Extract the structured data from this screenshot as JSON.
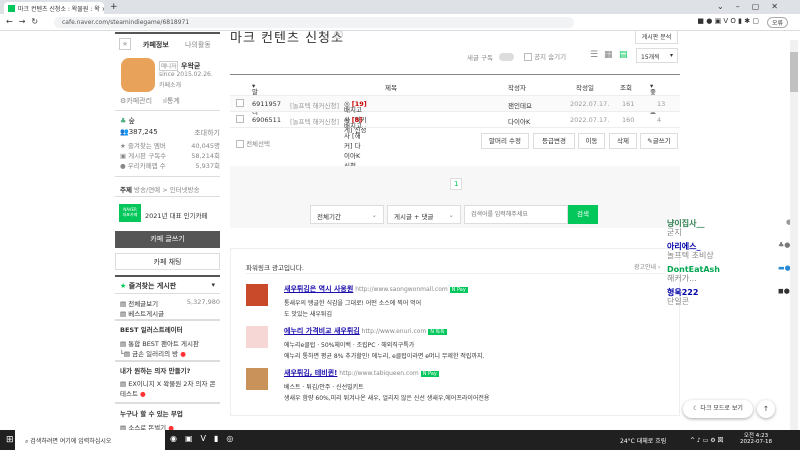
{
  "browser": {
    "tab_title": "마크 컨텐츠 신청소 : 왁물원 : 왁",
    "url": "cafe.naver.com/steamindiegame/6818971",
    "profile_label": "오류"
  },
  "sidebar": {
    "tabs": [
      "카페정보",
      "나의활동"
    ],
    "manager_label": "매니저",
    "manager_name": "우왁굳",
    "since": "since 2015.02.26.",
    "cafe_intro": "카페소개",
    "cafe_manage": "카페관리",
    "stats": "통계",
    "level": "숲",
    "members": "387,245",
    "invite": "초대하기",
    "stat_rows": [
      {
        "label": "즐겨찾는 멤버",
        "value": "40,045명"
      },
      {
        "label": "게시판 구독수",
        "value": "58,214회"
      },
      {
        "label": "우리카페앱 수",
        "value": "5,937회"
      }
    ],
    "topic_label": "주제",
    "topic": "방송/연예 > 인터넷방송",
    "naver_badge": "NAVER 대표카페",
    "award": "2021년 대표 인기카페",
    "write_btn": "카페 글쓰기",
    "chat_btn": "카페 채팅",
    "fav_header": "즐겨찾는 게시판",
    "boards": [
      {
        "label": "전체글보기",
        "count": "5,327,980"
      },
      {
        "label": "베스트게시글"
      }
    ],
    "sections": [
      {
        "title": "BEST 일러스트레이터",
        "items": [
          "통합 BEST 팬아트 게시판",
          "금손 일러리의 방"
        ]
      },
      {
        "title": "내가 원하는 의자 만들기?",
        "items": [
          "EX이니지 X 왁물원 2차 의자 콘테스트"
        ]
      },
      {
        "title": "누구나 할 수 있는 부업",
        "items": [
          "소스로 돈벌기"
        ]
      }
    ]
  },
  "main": {
    "title": "마크 컨텐츠 신청소",
    "analyze_btn": "게시판 분석",
    "subscribe": "새글 구독",
    "hide_notice": "공지 숨기기",
    "per_page": "15개씩",
    "columns": [
      "말머리",
      "제목",
      "작성자",
      "작성일",
      "조회",
      "좋아요"
    ],
    "rows": [
      {
        "id": "6911957",
        "prefix": "[놀프텍 해커신청]",
        "title": "배치고사 [마키게] 신청",
        "comments": "[19]",
        "author": "잰인데요",
        "date": "2022.07.17.",
        "views": "161",
        "likes": "13"
      },
      {
        "id": "6906511",
        "prefix": "[놀프텍 해커신청]",
        "title": "배치고사 [해커] 다이아K 신청",
        "comments": "[8]",
        "author": "다이아K",
        "date": "2022.07.17.",
        "views": "160",
        "likes": "4"
      }
    ],
    "select_all": "전체선택",
    "actions": [
      "말머리 수정",
      "등급변경",
      "이동",
      "삭제",
      "글쓰기"
    ],
    "page": "1",
    "search": {
      "period": "전체기간",
      "scope": "게시글 + 댓글",
      "placeholder": "검색어를 입력해주세요",
      "button": "검색"
    }
  },
  "ads": {
    "header": "파워링크 광고입니다.",
    "guide": "광고안내",
    "items": [
      {
        "title": "새우튀김은 역시 사옹원",
        "url": "http://www.saongwonmall.com",
        "badge": "N Pay",
        "lines": [
          "통새우의 탱글한 식감을 그대로! 어떤 소스에 찍어 먹어",
          "도 맛있는 새우튀김"
        ]
      },
      {
        "title": "에누리 가격비교 새우튀김",
        "url": "http://www.enuri.com",
        "badge": "N 톡톡",
        "lines": [
          "에누리e클럽 · 50%체이백 · 조립PC · 해외직구특가",
          "에누리 통하면 평균 8% 추가할인! 에누리, e클럽이라면 e머니 무제한 적립까지."
        ]
      },
      {
        "title": "새우튀김, 테비퀸!",
        "url": "http://www.tabiqueen.com",
        "badge": "N Pay",
        "lines": [
          "베스트 · 튀김/안주 · 신선밀키트",
          "생새우 함량 60%,미리 튀겨나온 새우, 얼리지 않은 신선 생새우,에어프라이어전용"
        ]
      }
    ]
  },
  "chat": [
    {
      "name": "냥이집사__",
      "msg": "굳지",
      "color": "#2e7d4f"
    },
    {
      "name": "아리에스_",
      "msg": "놀프텍 초비상",
      "color": "#0000aa"
    },
    {
      "name": "DontEatAsh",
      "msg": "해커가...",
      "color": "#00a650"
    },
    {
      "name": "형욱222",
      "msg": "단일콘",
      "color": "#0000aa"
    }
  ],
  "floating": {
    "dark_mode": "다크 모드로 보기"
  },
  "taskbar": {
    "search": "검색하려면 여기에 입력하십시오",
    "weather": "24°C 대체로 흐림",
    "time": "오전 4:23",
    "date": "2022-07-18"
  }
}
